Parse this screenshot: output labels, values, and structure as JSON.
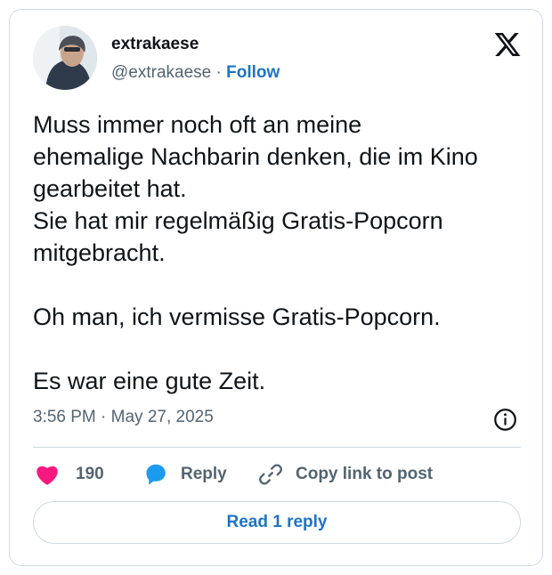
{
  "author": {
    "display_name": "extrakaese",
    "handle": "@extrakaese",
    "separator": " · ",
    "follow_label": "Follow"
  },
  "tweet": {
    "text": "Muss immer noch oft an meine\nehemalige Nachbarin denken, die im Kino\ngearbeitet hat.\nSie hat mir regelmäßig Gratis-Popcorn\nmitgebracht.\n\nOh man, ich vermisse Gratis-Popcorn.\n\nEs war eine gute Zeit.",
    "timestamp": "3:56 PM · May 27, 2025"
  },
  "actions": {
    "like_count": "190",
    "reply_label": "Reply",
    "copy_link_label": "Copy link to post"
  },
  "thread_button": {
    "label": "Read 1 reply"
  },
  "icons": {
    "logo": "x-logo-icon",
    "info": "info-icon",
    "like": "heart-icon",
    "reply": "speech-bubble-icon",
    "copy": "link-icon"
  },
  "colors": {
    "heart": "#f91880",
    "reply_bubble": "#1d9bf0",
    "link_blue": "#1d74c7",
    "muted": "#536471",
    "border": "#cfd9de"
  }
}
